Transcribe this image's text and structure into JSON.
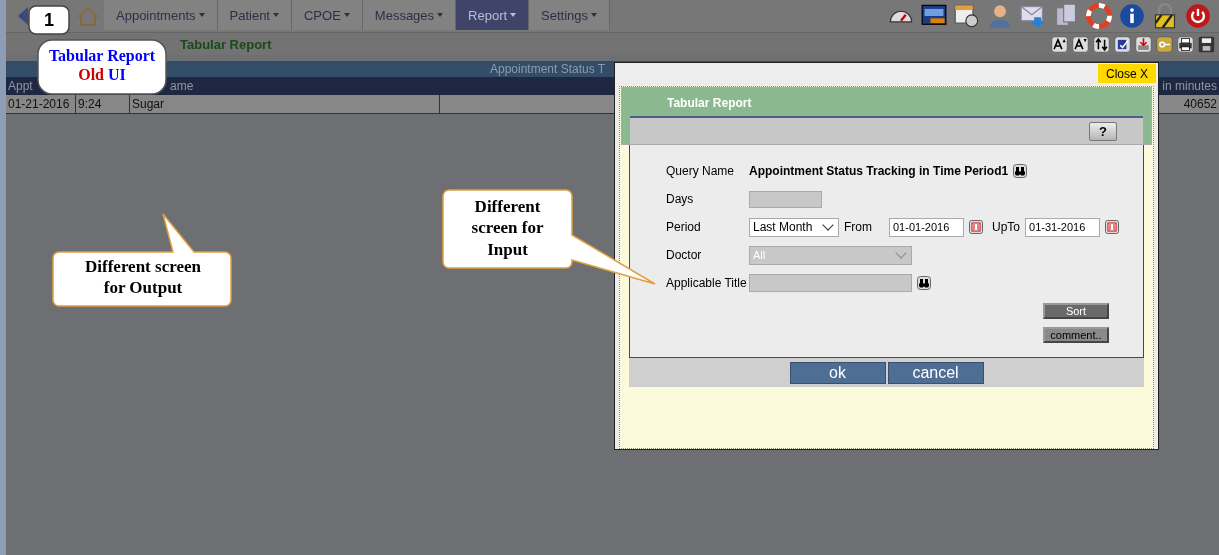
{
  "nav": {
    "tabs": [
      {
        "label": "Appointments",
        "selected": false
      },
      {
        "label": "Patient",
        "selected": false
      },
      {
        "label": "CPOE",
        "selected": false
      },
      {
        "label": "Messages",
        "selected": false
      },
      {
        "label": "Report",
        "selected": true
      },
      {
        "label": "Settings",
        "selected": false
      }
    ]
  },
  "page_title": "Tabular Report",
  "report": {
    "banner": "Appointment Status T",
    "header": {
      "column_1": "Appt",
      "column_3": "ame",
      "column_5": "in minutes"
    },
    "rows": [
      {
        "column_1": "01-21-2016",
        "column_2": "9:24",
        "column_3": "Sugar",
        "column_5": "40652"
      }
    ]
  },
  "dialog": {
    "close_label": "Close X",
    "title": "Tabular Report",
    "help_label": "?",
    "fields": [
      {
        "kind": "text",
        "label": "Query Name",
        "value": "Appointment Status Tracking in Time Period1"
      },
      {
        "kind": "input",
        "label": "Days",
        "disabled": true
      },
      {
        "kind": "period",
        "label": "Period",
        "value": "Last Month",
        "from_label": "From",
        "from": "01-01-2016",
        "upto_label": "UpTo",
        "upto": "01-31-2016"
      },
      {
        "kind": "select",
        "label": "Doctor",
        "value": "All",
        "disabled": true
      },
      {
        "kind": "lookup",
        "label": "Applicable Title",
        "disabled": true
      }
    ],
    "side_buttons": [
      "Sort",
      "comment.."
    ],
    "buttons": [
      "ok",
      "cancel"
    ]
  },
  "callouts": [
    {
      "kind": "badge",
      "lines": [
        [
          {
            "text": "1"
          }
        ]
      ]
    },
    {
      "kind": "plain",
      "lines": [
        [
          {
            "text": "Tabular Report",
            "color": "#0000ff"
          }
        ],
        [
          {
            "text": "Old",
            "color": "#cc0000"
          },
          {
            "text": "UI",
            "color": "#0000ff"
          }
        ]
      ]
    },
    {
      "kind": "tail-right",
      "lines": [
        [
          {
            "text": "Different"
          }
        ],
        [
          {
            "text": "screen for"
          }
        ],
        [
          {
            "text": "Input"
          }
        ]
      ]
    },
    {
      "kind": "tail-up",
      "lines": [
        [
          {
            "text": "Different screen"
          }
        ],
        [
          {
            "text": "for Output"
          }
        ]
      ]
    }
  ]
}
